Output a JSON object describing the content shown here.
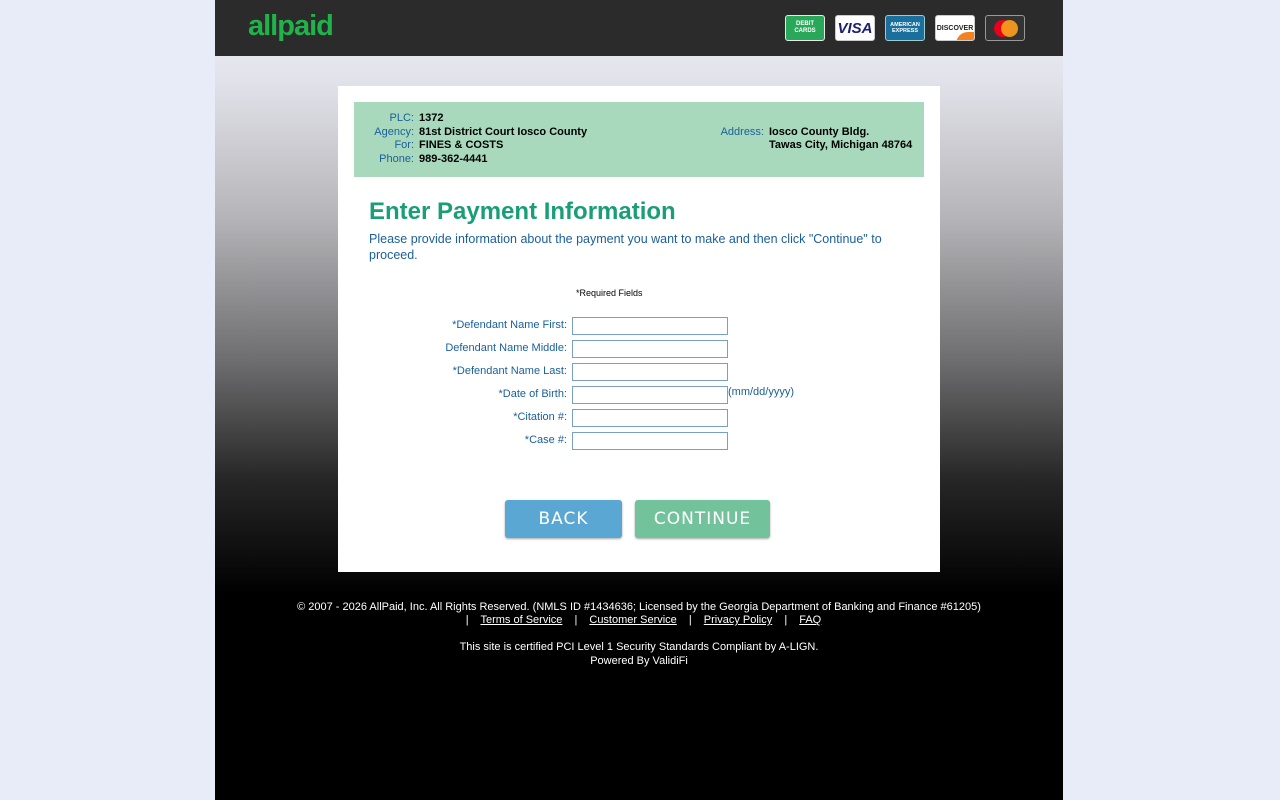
{
  "header": {
    "logo": "allpaid",
    "cards": {
      "debit_line1": "DEBIT",
      "debit_line2": "CARDS",
      "visa": "VISA",
      "amex_line1": "AMERICAN",
      "amex_line2": "EXPRESS",
      "discover": "DISCOVER"
    }
  },
  "info": {
    "plc_label": "PLC:",
    "plc_value": "1372",
    "agency_label": "Agency:",
    "agency_value": "81st District Court Iosco County",
    "for_label": "For:",
    "for_value": "FINES & COSTS",
    "phone_label": "Phone:",
    "phone_value": "989-362-4441",
    "address_label": "Address:",
    "address_line1": "Iosco County Bldg.",
    "address_line2": "Tawas City, Michigan 48764"
  },
  "main": {
    "heading": "Enter Payment Information",
    "instructions": "Please provide information about the payment you want to make and then click \"Continue\" to proceed.",
    "required_note": "*Required Fields"
  },
  "form": {
    "first_name_label": "*Defendant Name First:",
    "first_name_value": "",
    "middle_name_label": "Defendant Name Middle:",
    "middle_name_value": "",
    "last_name_label": "*Defendant Name Last:",
    "last_name_value": "",
    "dob_label": "*Date of Birth:",
    "dob_value": "",
    "dob_hint": "(mm/dd/yyyy)",
    "citation_label": "*Citation #:",
    "citation_value": "",
    "case_label": "*Case #:",
    "case_value": ""
  },
  "buttons": {
    "back": "BACK",
    "continue": "CONTINUE"
  },
  "footer": {
    "copyright": "© 2007 - 2026 AllPaid, Inc. All Rights Reserved. (NMLS ID #1434636; Licensed by the Georgia Department of Banking and Finance #61205)",
    "separator": "|",
    "terms": "Terms of Service",
    "customer_service": "Customer Service",
    "privacy": "Privacy Policy",
    "faq": "FAQ",
    "certified": "This site is certified PCI Level 1 Security Standards Compliant by A-LIGN.",
    "powered": "Powered By ValidiFi"
  },
  "colors": {
    "logo_green": "#1fb34a",
    "heading_green": "#1a9e77",
    "label_blue": "#1a5f99",
    "info_bg": "#a9d9bd",
    "back_button": "#5aa7d3",
    "continue_button": "#72c39c"
  }
}
